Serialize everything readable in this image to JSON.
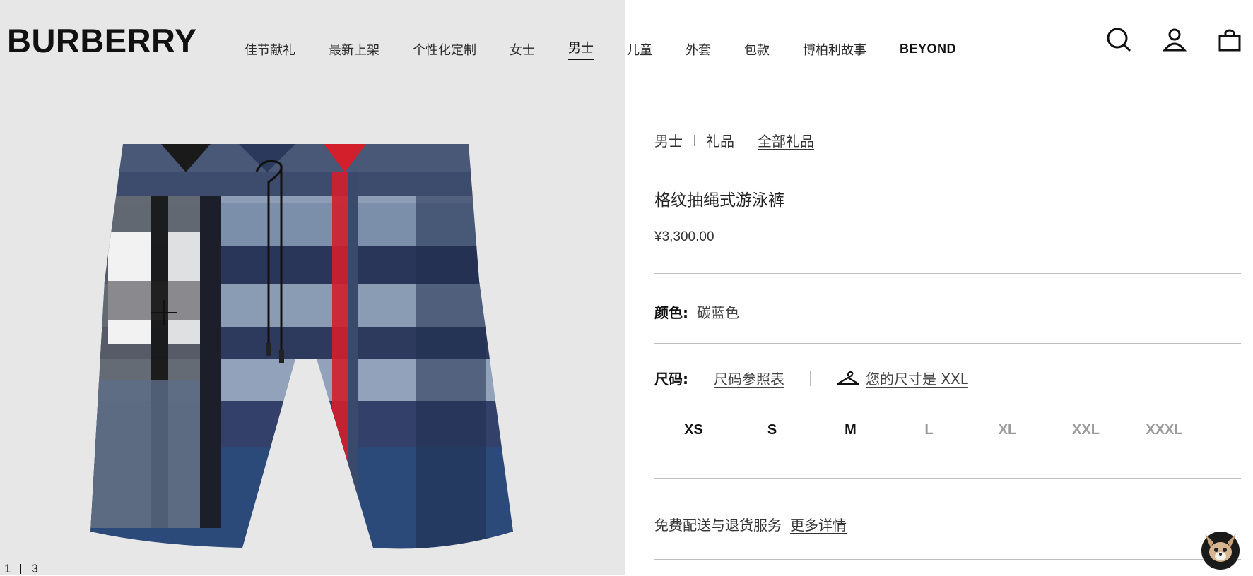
{
  "brand": {
    "logo_text": "BURBERRY"
  },
  "nav": {
    "items": [
      {
        "label": "佳节献礼"
      },
      {
        "label": "最新上架"
      },
      {
        "label": "个性化定制"
      },
      {
        "label": "女士"
      },
      {
        "label": "男士",
        "active": true
      },
      {
        "label": "儿童"
      },
      {
        "label": "外套"
      },
      {
        "label": "包款"
      },
      {
        "label": "博柏利故事"
      },
      {
        "label": "BEYOND"
      }
    ]
  },
  "header_icons": [
    "search-icon",
    "account-icon",
    "shopping-bag-icon"
  ],
  "gallery": {
    "current": "1",
    "total": "3"
  },
  "breadcrumb": {
    "items": [
      "男士",
      "礼品",
      "全部礼品"
    ]
  },
  "product": {
    "title": "格纹抽绳式游泳裤",
    "price": "¥3,300.00",
    "color_label": "颜色:",
    "color_value": "碳蓝色",
    "size_label": "尺码:",
    "size_chart_link": "尺码参照表",
    "fit_text": "您的尺寸是 XXL",
    "sizes": [
      {
        "label": "XS",
        "available": true
      },
      {
        "label": "S",
        "available": true
      },
      {
        "label": "M",
        "available": true
      },
      {
        "label": "L",
        "available": false
      },
      {
        "label": "XL",
        "available": false
      },
      {
        "label": "XXL",
        "available": false
      },
      {
        "label": "XXXL",
        "available": false
      }
    ]
  },
  "delivery": {
    "text": "免费配送与退货服务",
    "more_link": "更多详情"
  },
  "colors": {
    "navy": "#1f2d4f",
    "check_red": "#d21f2b",
    "panel_bg": "#e7e7e8"
  }
}
